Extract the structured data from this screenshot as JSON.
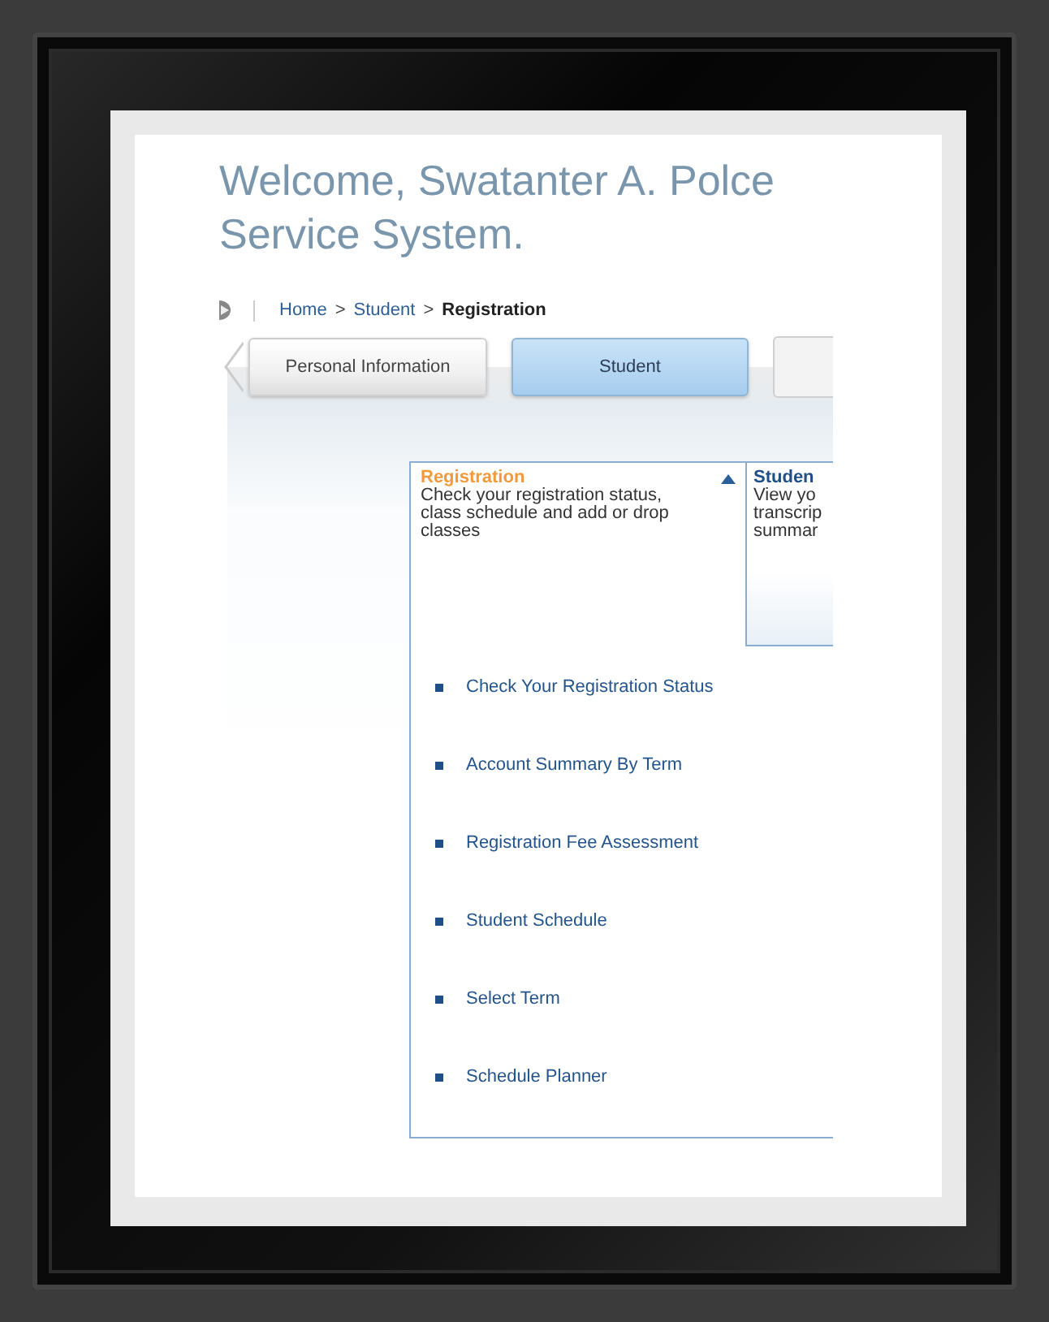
{
  "heading": [
    "Welcome, Swatanter A. Polce",
    "Service System."
  ],
  "breadcrumb": [
    {
      "label": "Home",
      "current": false
    },
    {
      "label": "Student",
      "current": false
    },
    {
      "label": "Registration",
      "current": true
    }
  ],
  "breadcrumb_separator": ">",
  "tabs": [
    {
      "label": "Personal Information",
      "selected": false
    },
    {
      "label": "Student",
      "selected": true
    }
  ],
  "cards": [
    {
      "title": "Registration",
      "description": "Check your registration status, class schedule and add or drop classes",
      "expanded": true
    },
    {
      "title": "Studen",
      "description_lines": [
        "View yo",
        "transcrip",
        "summar"
      ],
      "expanded": false
    }
  ],
  "links": [
    "Check Your Registration Status",
    "Account Summary By Term",
    "Registration Fee Assessment",
    "Student Schedule",
    "Select Term",
    "Schedule Planner"
  ]
}
